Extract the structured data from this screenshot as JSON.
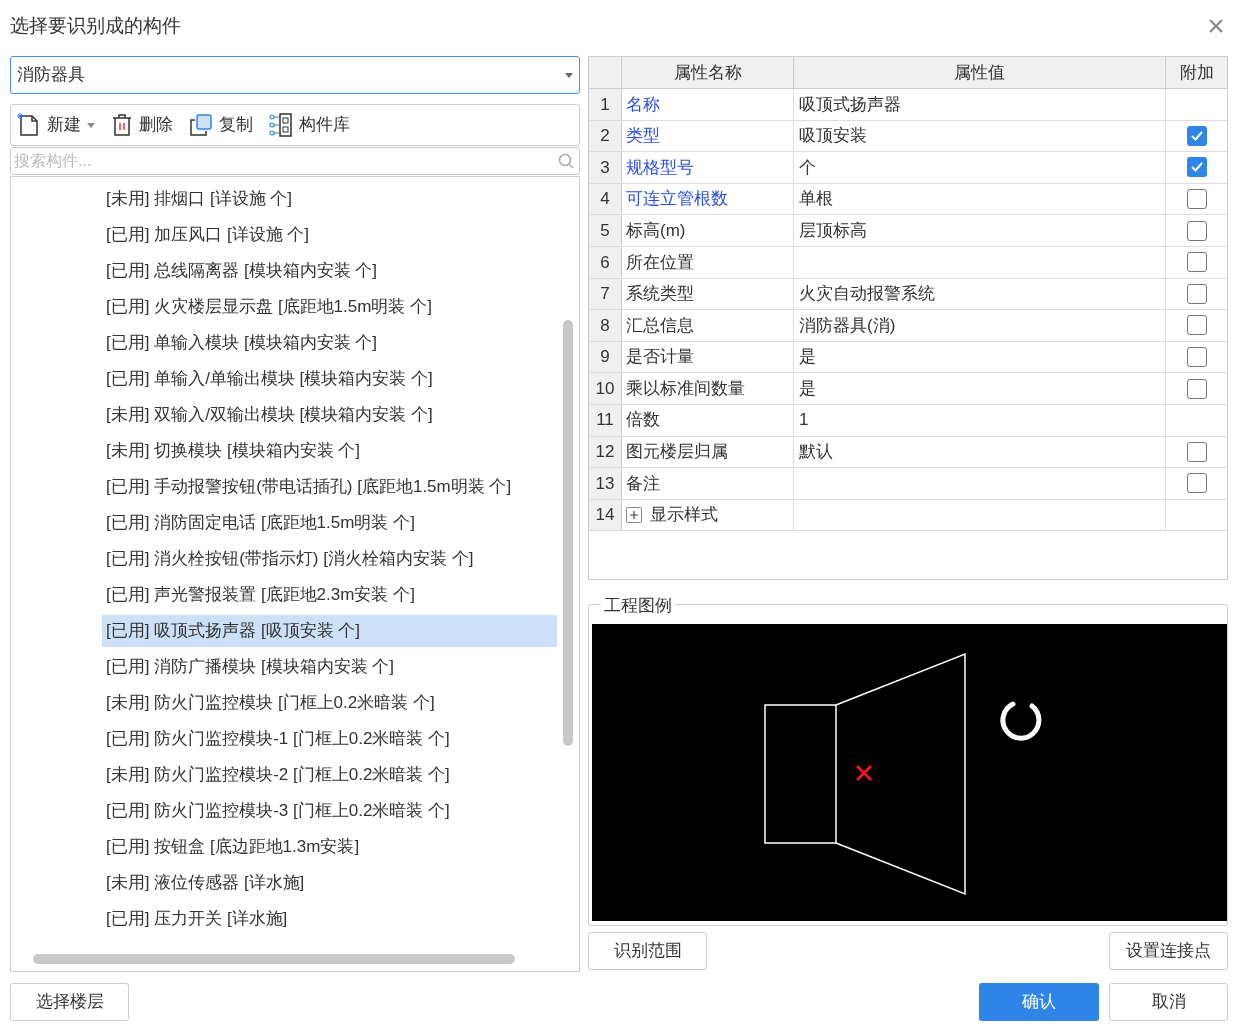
{
  "window": {
    "title": "选择要识别成的构件",
    "close": "×"
  },
  "category_dropdown": {
    "value": "消防器具"
  },
  "toolbar": [
    {
      "kind": "new",
      "label": "新建",
      "has_menu": true
    },
    {
      "kind": "delete",
      "label": "删除",
      "has_menu": false
    },
    {
      "kind": "copy",
      "label": "复制",
      "has_menu": false
    },
    {
      "kind": "library",
      "label": "构件库",
      "has_menu": false
    }
  ],
  "search": {
    "placeholder": "搜索构件..."
  },
  "components": [
    {
      "label": "[未用] 排烟口 [详设施 个]",
      "selected": false
    },
    {
      "label": "[已用] 加压风口 [详设施 个]",
      "selected": false
    },
    {
      "label": "[已用] 总线隔离器 [模块箱内安装 个]",
      "selected": false
    },
    {
      "label": "[已用] 火灾楼层显示盘 [底距地1.5m明装 个]",
      "selected": false
    },
    {
      "label": "[已用] 单输入模块 [模块箱内安装 个]",
      "selected": false
    },
    {
      "label": "[已用] 单输入/单输出模块 [模块箱内安装 个]",
      "selected": false
    },
    {
      "label": "[未用] 双输入/双输出模块 [模块箱内安装 个]",
      "selected": false
    },
    {
      "label": "[未用] 切换模块 [模块箱内安装 个]",
      "selected": false
    },
    {
      "label": "[已用] 手动报警按钮(带电话插孔) [底距地1.5m明装 个]",
      "selected": false
    },
    {
      "label": "[已用] 消防固定电话 [底距地1.5m明装 个]",
      "selected": false
    },
    {
      "label": "[已用] 消火栓按钮(带指示灯) [消火栓箱内安装 个]",
      "selected": false
    },
    {
      "label": "[已用] 声光警报装置 [底距地2.3m安装 个]",
      "selected": false
    },
    {
      "label": "[已用] 吸顶式扬声器 [吸顶安装 个]",
      "selected": true
    },
    {
      "label": "[已用] 消防广播模块 [模块箱内安装 个]",
      "selected": false
    },
    {
      "label": "[未用] 防火门监控模块 [门框上0.2米暗装 个]",
      "selected": false
    },
    {
      "label": "[已用] 防火门监控模块-1 [门框上0.2米暗装 个]",
      "selected": false
    },
    {
      "label": "[未用] 防火门监控模块-2 [门框上0.2米暗装 个]",
      "selected": false
    },
    {
      "label": "[已用] 防火门监控模块-3 [门框上0.2米暗装 个]",
      "selected": false
    },
    {
      "label": "[已用] 按钮盒 [底边距地1.3m安装]",
      "selected": false
    },
    {
      "label": "[未用] 液位传感器 [详水施]",
      "selected": false
    },
    {
      "label": "[已用] 压力开关 [详水施]",
      "selected": false
    }
  ],
  "properties": {
    "columns": [
      "属性名称",
      "属性值",
      "附加"
    ],
    "rows": [
      {
        "index": "1",
        "name": "名称",
        "value": "吸顶式扬声器",
        "highlighted": true,
        "kind": "plain"
      },
      {
        "index": "2",
        "name": "类型",
        "value": "吸顶安装",
        "highlighted": true,
        "kind": "checkbox",
        "checked": true
      },
      {
        "index": "3",
        "name": "规格型号",
        "value": "个",
        "highlighted": true,
        "kind": "checkbox",
        "checked": true
      },
      {
        "index": "4",
        "name": "可连立管根数",
        "value": "单根",
        "highlighted": true,
        "kind": "checkbox",
        "checked": false
      },
      {
        "index": "5",
        "name": "标高(m)",
        "value": "层顶标高",
        "highlighted": false,
        "kind": "checkbox",
        "checked": false
      },
      {
        "index": "6",
        "name": "所在位置",
        "highlighted": false,
        "kind": "checkbox",
        "checked": false
      },
      {
        "index": "7",
        "name": "系统类型",
        "value": "火灾自动报警系统",
        "highlighted": false,
        "kind": "checkbox",
        "checked": false
      },
      {
        "index": "8",
        "name": "汇总信息",
        "value": "消防器具(消)",
        "highlighted": false,
        "kind": "checkbox",
        "checked": false
      },
      {
        "index": "9",
        "name": "是否计量",
        "value": "是",
        "highlighted": false,
        "kind": "checkbox",
        "checked": false
      },
      {
        "index": "10",
        "name": "乘以标准间数量",
        "value": "是",
        "highlighted": false,
        "kind": "checkbox",
        "checked": false
      },
      {
        "index": "11",
        "name": "倍数",
        "value": "1",
        "highlighted": false,
        "kind": "plain"
      },
      {
        "index": "12",
        "name": "图元楼层归属",
        "value": "默认",
        "highlighted": false,
        "kind": "checkbox",
        "checked": false
      },
      {
        "index": "13",
        "name": "备注",
        "highlighted": false,
        "kind": "checkbox",
        "checked": false
      },
      {
        "index": "14",
        "name": "显示样式",
        "highlighted": false,
        "kind": "group",
        "expanded": false
      }
    ]
  },
  "legend": {
    "title": "工程图例"
  },
  "legend_buttons": [
    "识别范围",
    "设置连接点"
  ],
  "footer": {
    "floor_button": "选择楼层",
    "confirm": "确认",
    "cancel": "取消"
  }
}
